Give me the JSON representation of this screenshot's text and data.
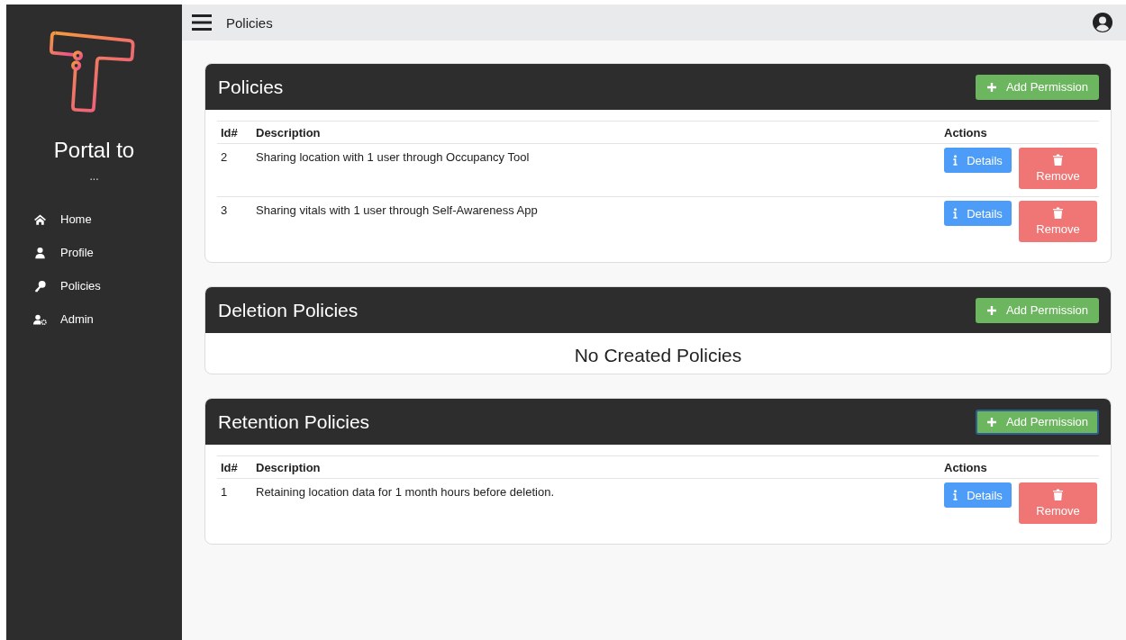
{
  "sidebar": {
    "title": "Portal to",
    "subtitle": "...",
    "items": [
      {
        "label": "Home",
        "kind": "home"
      },
      {
        "label": "Profile",
        "kind": "user"
      },
      {
        "label": "Policies",
        "kind": "key"
      },
      {
        "label": "Admin",
        "kind": "admin"
      }
    ]
  },
  "topbar": {
    "title": "Policies"
  },
  "sections": [
    {
      "title": "Policies",
      "add_button": {
        "label": "Add Permission",
        "focused": false
      },
      "columns": [
        "Id#",
        "Description",
        "Actions"
      ],
      "rows": [
        {
          "id": "2",
          "description": "Sharing location with 1 user through Occupancy Tool",
          "details": "Details",
          "remove": "Remove"
        },
        {
          "id": "3",
          "description": "Sharing vitals with 1 user through Self-Awareness App",
          "details": "Details",
          "remove": "Remove"
        }
      ]
    },
    {
      "title": "Deletion Policies",
      "add_button": {
        "label": "Add Permission",
        "focused": false
      },
      "empty_message": "No Created Policies"
    },
    {
      "title": "Retention Policies",
      "add_button": {
        "label": "Add Permission",
        "focused": true
      },
      "columns": [
        "Id#",
        "Description",
        "Actions"
      ],
      "rows": [
        {
          "id": "1",
          "description": "Retaining location data for 1 month hours before deletion.",
          "details": "Details",
          "remove": "Remove"
        }
      ]
    }
  ]
}
